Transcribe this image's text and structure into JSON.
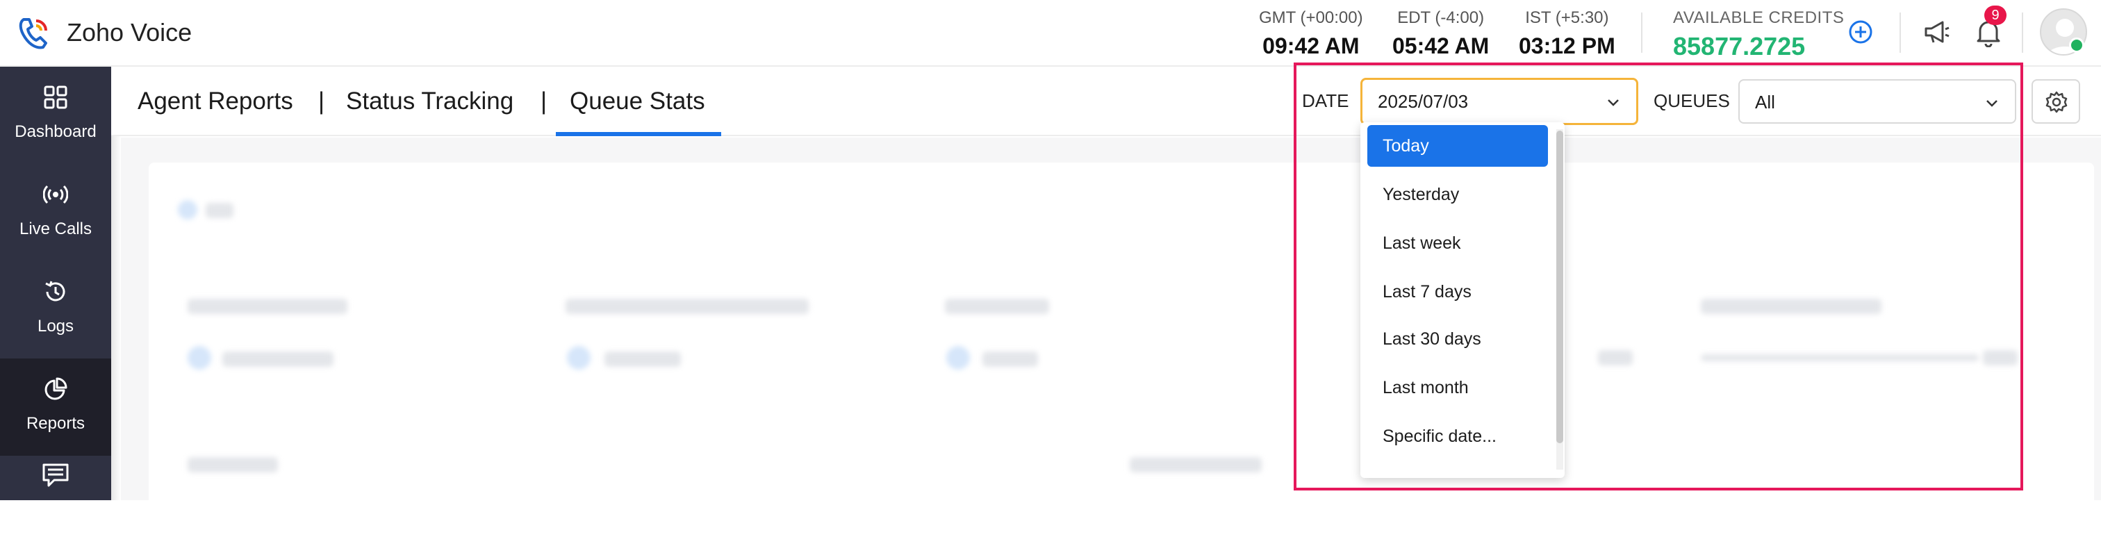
{
  "app": {
    "name": "Zoho Voice"
  },
  "timezones": [
    {
      "label": "GMT (+00:00)",
      "time": "09:42 AM"
    },
    {
      "label": "EDT (-4:00)",
      "time": "05:42 AM"
    },
    {
      "label": "IST (+5:30)",
      "time": "03:12 PM"
    }
  ],
  "credits": {
    "label": "AVAILABLE CREDITS",
    "value": "85877.2725"
  },
  "notifications": {
    "count": "9"
  },
  "sidebar": {
    "items": [
      {
        "label": "Dashboard",
        "icon": "grid-icon"
      },
      {
        "label": "Live Calls",
        "icon": "broadcast-icon"
      },
      {
        "label": "Logs",
        "icon": "history-icon"
      },
      {
        "label": "Reports",
        "icon": "pie-chart-icon",
        "active": true
      },
      {
        "label": "",
        "icon": "message-icon"
      }
    ]
  },
  "tabs": [
    {
      "label": "Agent Reports"
    },
    {
      "label": "Status Tracking"
    },
    {
      "label": "Queue Stats",
      "active": true
    }
  ],
  "separator": "|",
  "filters": {
    "date_label": "DATE",
    "date_value": "2025/07/03",
    "queues_label": "QUEUES",
    "queues_value": "All"
  },
  "date_options": [
    "Today",
    "Yesterday",
    "Last week",
    "Last 7 days",
    "Last 30 days",
    "Last month",
    "Specific date..."
  ],
  "selected_option": "Today",
  "colors": {
    "accent": "#1a73e8",
    "credits": "#22b573",
    "highlight_box": "#e5185b",
    "focus": "#f5b43a",
    "sidebar": "#2f3142"
  }
}
